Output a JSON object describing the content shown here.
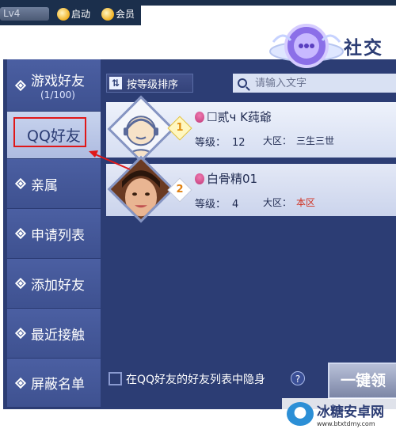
{
  "topbar": {
    "level": "Lv4",
    "btn_start": "启动",
    "btn_vip": "会员"
  },
  "panel": {
    "title": "社交"
  },
  "sidebar": {
    "items": [
      {
        "label": "游戏好友",
        "sub": "(1/100)"
      },
      {
        "label": "QQ好友"
      },
      {
        "label": "亲属"
      },
      {
        "label": "申请列表"
      },
      {
        "label": "添加好友"
      },
      {
        "label": "最近接触"
      },
      {
        "label": "屏蔽名单"
      }
    ]
  },
  "toolbar": {
    "sort_label": "按等级排序",
    "search_placeholder": "请输入文字"
  },
  "friends": [
    {
      "rank": "1",
      "name": "☐贰ч K莼爺",
      "level_label": "等级：",
      "level": "12",
      "region_label": "大区：",
      "region": "三生三世"
    },
    {
      "rank": "2",
      "name": "白骨精01",
      "level_label": "等级：",
      "level": "4",
      "region_label": "大区：",
      "region": "本区"
    }
  ],
  "footer": {
    "hide_label": "在QQ好友的好友列表中隐身",
    "help": "?",
    "one_key": "一键领"
  },
  "watermark": {
    "text": "冰糖安卓网",
    "sub": "www.btxtdmy.com"
  },
  "colors": {
    "panel": "#2c3d74",
    "highlight_box": "#e01818",
    "region_local": "#d03020"
  }
}
